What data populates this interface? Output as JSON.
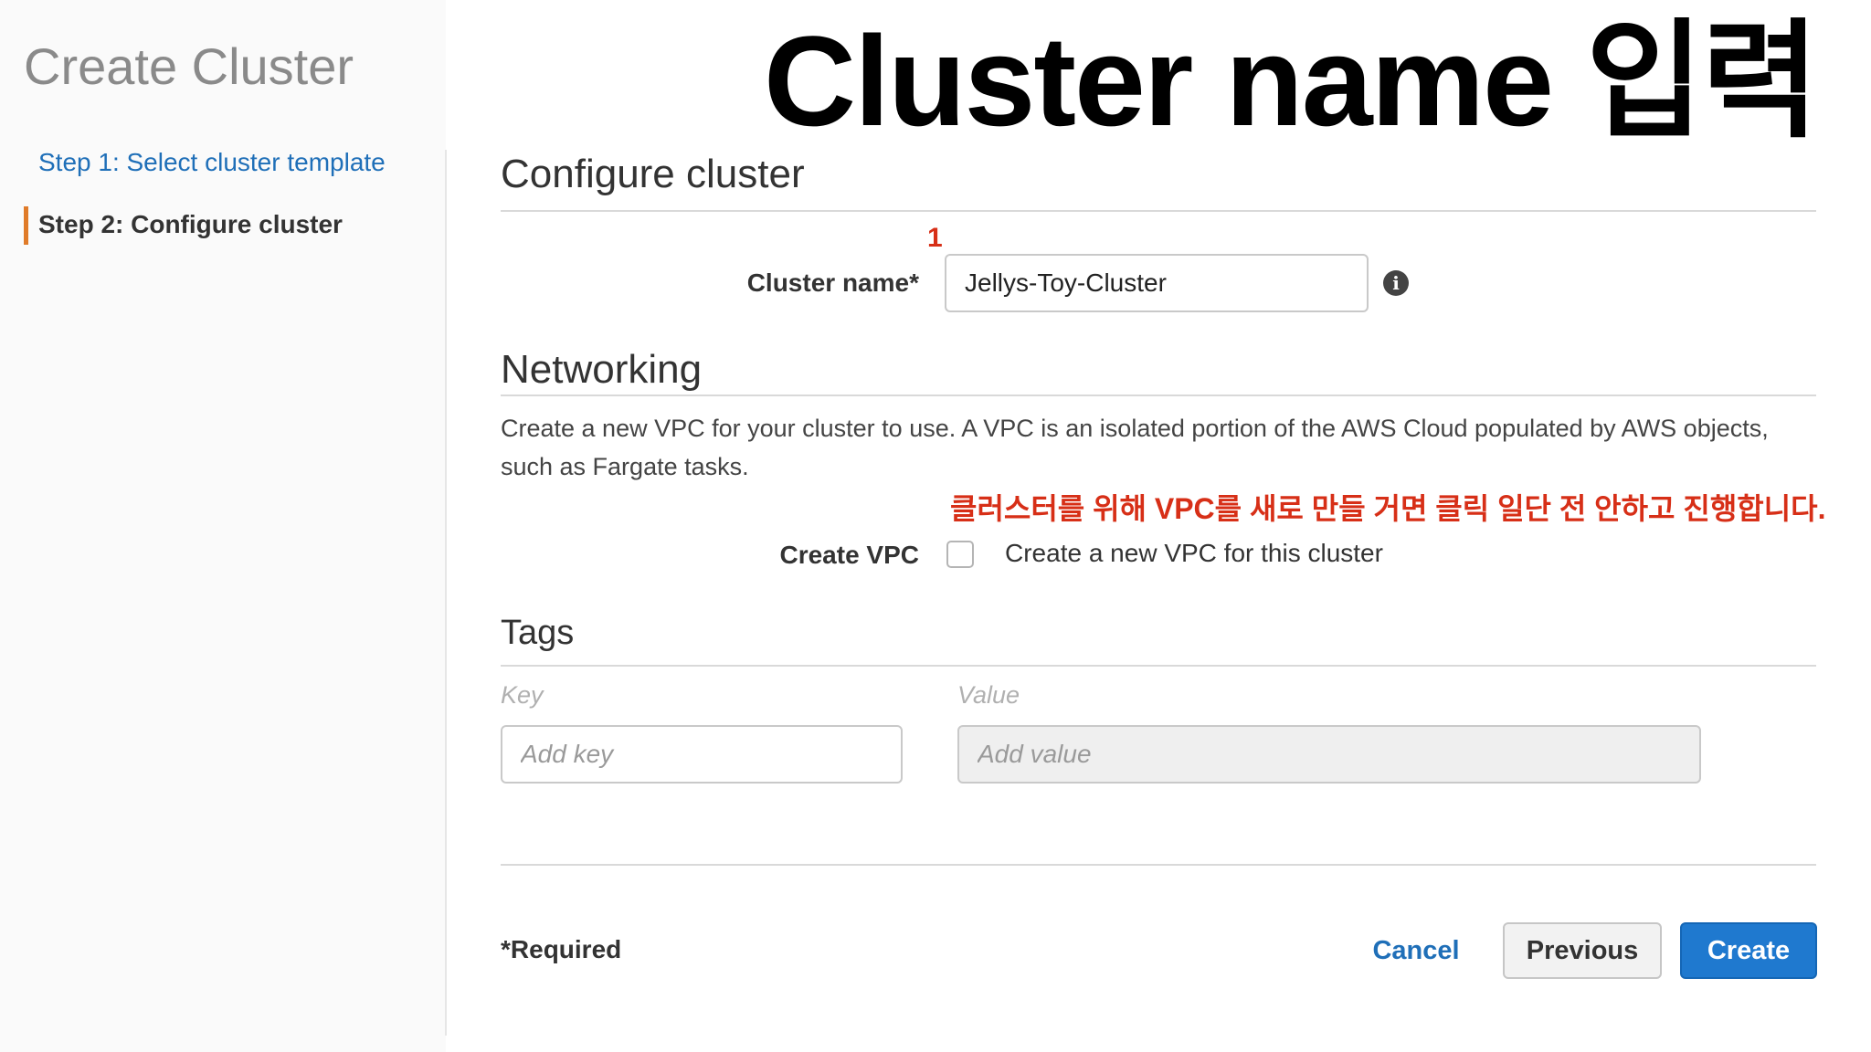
{
  "overlay": {
    "title": "Cluster name 입력"
  },
  "sidebar": {
    "title": "Create Cluster",
    "steps": [
      {
        "label": "Step 1: Select cluster template"
      },
      {
        "label": "Step 2: Configure cluster"
      }
    ]
  },
  "configure": {
    "title": "Configure cluster",
    "cluster_name_label": "Cluster name*",
    "cluster_name_value": "Jellys-Toy-Cluster",
    "annotation_number": "1"
  },
  "networking": {
    "title": "Networking",
    "description": "Create a new VPC for your cluster to use. A VPC is an isolated portion of the AWS Cloud populated by AWS objects, such as Fargate tasks.",
    "annotation_note": "클러스터를 위해 VPC를 새로 만들 거면 클릭 일단 전 안하고 진행합니다.",
    "create_vpc_label": "Create VPC",
    "create_vpc_checkbox_label": "Create a new VPC for this cluster"
  },
  "tags": {
    "title": "Tags",
    "key_header": "Key",
    "value_header": "Value",
    "key_placeholder": "Add key",
    "value_placeholder": "Add value"
  },
  "footer": {
    "required_note": "*Required",
    "cancel_label": "Cancel",
    "previous_label": "Previous",
    "create_label": "Create"
  },
  "colors": {
    "accent_blue": "#1f79cf",
    "link_blue": "#1f6fb8",
    "annotation_red": "#d72f17",
    "step_marker_orange": "#e07b29"
  }
}
